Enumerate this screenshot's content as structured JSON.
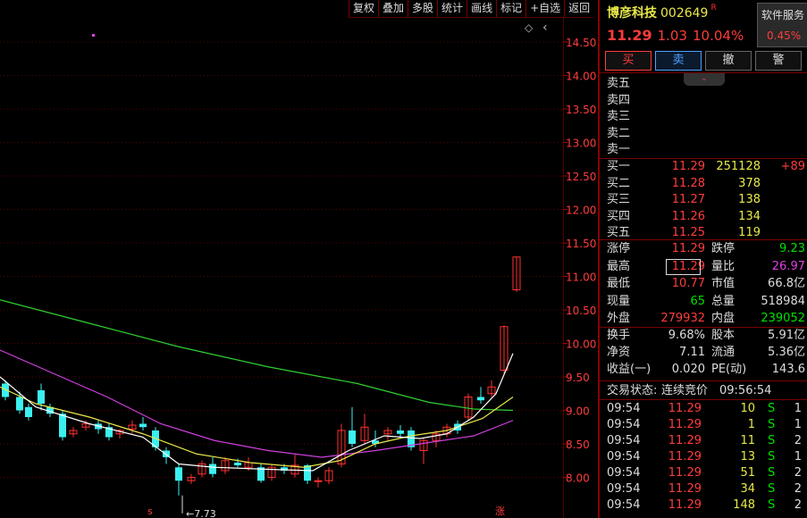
{
  "toolbar": {
    "items": [
      "复权",
      "叠加",
      "多股",
      "统计",
      "画线",
      "标记",
      "+自选",
      "返回"
    ]
  },
  "chart": {
    "price_labels": [
      "14.50",
      "14.00",
      "13.50",
      "13.00",
      "12.50",
      "12.00",
      "11.50",
      "11.00",
      "10.50",
      "10.00",
      "9.50",
      "9.00",
      "8.50",
      "8.00"
    ],
    "low_annotation": "←7.73",
    "bottom_marker": "涨",
    "bottom_left_marker": "s",
    "diamond": "◇",
    "nav_arrow": "‹",
    "colors": {
      "up": "#ff3030",
      "down": "#3cf0f0",
      "ma_white": "#ffffff",
      "ma_yellow": "#e8e84a",
      "ma_magenta": "#d040e0",
      "ma_green": "#30d030"
    }
  },
  "stock": {
    "name": "博彦科技",
    "code": "002649",
    "tag": "R",
    "price": "11.29",
    "change": "1.03",
    "pct": "10.04%"
  },
  "sector": {
    "name": "软件服务",
    "pct": "0.45%"
  },
  "buttons": {
    "buy": "买",
    "sell": "卖",
    "cancel": "撤",
    "alert": "警"
  },
  "asks": [
    {
      "label": "卖五",
      "price": "",
      "vol": ""
    },
    {
      "label": "卖四",
      "price": "",
      "vol": ""
    },
    {
      "label": "卖三",
      "price": "",
      "vol": ""
    },
    {
      "label": "卖二",
      "price": "",
      "vol": ""
    },
    {
      "label": "卖一",
      "price": "",
      "vol": ""
    }
  ],
  "bids": [
    {
      "label": "买一",
      "price": "11.29",
      "vol": "251128",
      "chg": "+89"
    },
    {
      "label": "买二",
      "price": "11.28",
      "vol": "378",
      "chg": ""
    },
    {
      "label": "买三",
      "price": "11.27",
      "vol": "138",
      "chg": ""
    },
    {
      "label": "买四",
      "price": "11.26",
      "vol": "134",
      "chg": ""
    },
    {
      "label": "买五",
      "price": "11.25",
      "vol": "119",
      "chg": ""
    }
  ],
  "stats": [
    {
      "l1": "涨停",
      "v1": "11.29",
      "l2": "跌停",
      "v2": "9.23"
    },
    {
      "l1": "最高",
      "v1": "11.29",
      "l2": "量比",
      "v2": "26.97"
    },
    {
      "l1": "最低",
      "v1": "10.77",
      "l2": "市值",
      "v2": "66.8亿"
    },
    {
      "l1": "现量",
      "v1": "65",
      "l2": "总量",
      "v2": "518984"
    },
    {
      "l1": "外盘",
      "v1": "279932",
      "l2": "内盘",
      "v2": "239052"
    }
  ],
  "stats2": [
    {
      "l1": "换手",
      "v1": "9.68%",
      "l2": "股本",
      "v2": "5.91亿"
    },
    {
      "l1": "净资",
      "v1": "7.11",
      "l2": "流通",
      "v2": "5.36亿"
    },
    {
      "l1": "收益(一)",
      "v1": "0.020",
      "l2": "PE(动)",
      "v2": "143.6"
    }
  ],
  "trade_status": {
    "label": "交易状态:",
    "value": "连续竞价",
    "time": "09:56:54"
  },
  "ticks": [
    {
      "time": "09:54",
      "price": "11.29",
      "vol": "10",
      "side": "S",
      "n": "1"
    },
    {
      "time": "09:54",
      "price": "11.29",
      "vol": "1",
      "side": "S",
      "n": "1"
    },
    {
      "time": "09:54",
      "price": "11.29",
      "vol": "11",
      "side": "S",
      "n": "2"
    },
    {
      "time": "09:54",
      "price": "11.29",
      "vol": "13",
      "side": "S",
      "n": "1"
    },
    {
      "time": "09:54",
      "price": "11.29",
      "vol": "51",
      "side": "S",
      "n": "2"
    },
    {
      "time": "09:54",
      "price": "11.29",
      "vol": "34",
      "side": "S",
      "n": "2"
    },
    {
      "time": "09:54",
      "price": "11.29",
      "vol": "148",
      "side": "S",
      "n": "2"
    }
  ]
}
